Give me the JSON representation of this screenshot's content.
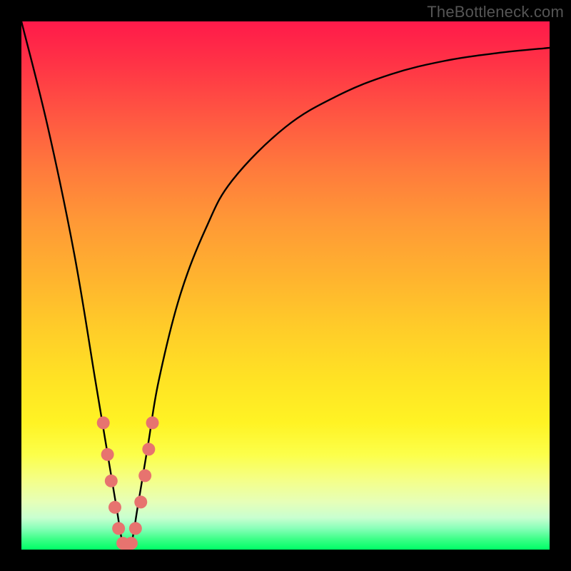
{
  "watermark": "TheBottleneck.com",
  "chart_data": {
    "type": "line",
    "title": "",
    "xlabel": "",
    "ylabel": "",
    "xlim": [
      0,
      100
    ],
    "ylim": [
      0,
      100
    ],
    "grid": false,
    "legend": false,
    "series": [
      {
        "name": "bottleneck-curve",
        "x": [
          0,
          5,
          10,
          14,
          16,
          18,
          19,
          20,
          21,
          22,
          24,
          26,
          30,
          35,
          40,
          50,
          60,
          70,
          80,
          90,
          100
        ],
        "values": [
          100,
          80,
          56,
          32,
          20,
          8,
          2,
          0,
          2,
          8,
          20,
          32,
          48,
          61,
          70,
          80,
          86,
          90,
          92.5,
          94,
          95
        ]
      }
    ],
    "markers": {
      "name": "highlight-points",
      "color": "#e7736f",
      "points": [
        {
          "x": 15.5,
          "y": 24
        },
        {
          "x": 16.3,
          "y": 18
        },
        {
          "x": 17.0,
          "y": 13
        },
        {
          "x": 17.7,
          "y": 8
        },
        {
          "x": 18.4,
          "y": 4
        },
        {
          "x": 19.2,
          "y": 1.2
        },
        {
          "x": 20.0,
          "y": 0.3
        },
        {
          "x": 20.8,
          "y": 1.2
        },
        {
          "x": 21.6,
          "y": 4
        },
        {
          "x": 22.6,
          "y": 9
        },
        {
          "x": 23.4,
          "y": 14
        },
        {
          "x": 24.1,
          "y": 19
        },
        {
          "x": 24.8,
          "y": 24
        }
      ]
    },
    "gradient_stops": [
      {
        "pos": 0,
        "color": "#ff1a4a"
      },
      {
        "pos": 50,
        "color": "#ffcc29"
      },
      {
        "pos": 82,
        "color": "#fcff4a"
      },
      {
        "pos": 100,
        "color": "#00ff66"
      }
    ]
  }
}
